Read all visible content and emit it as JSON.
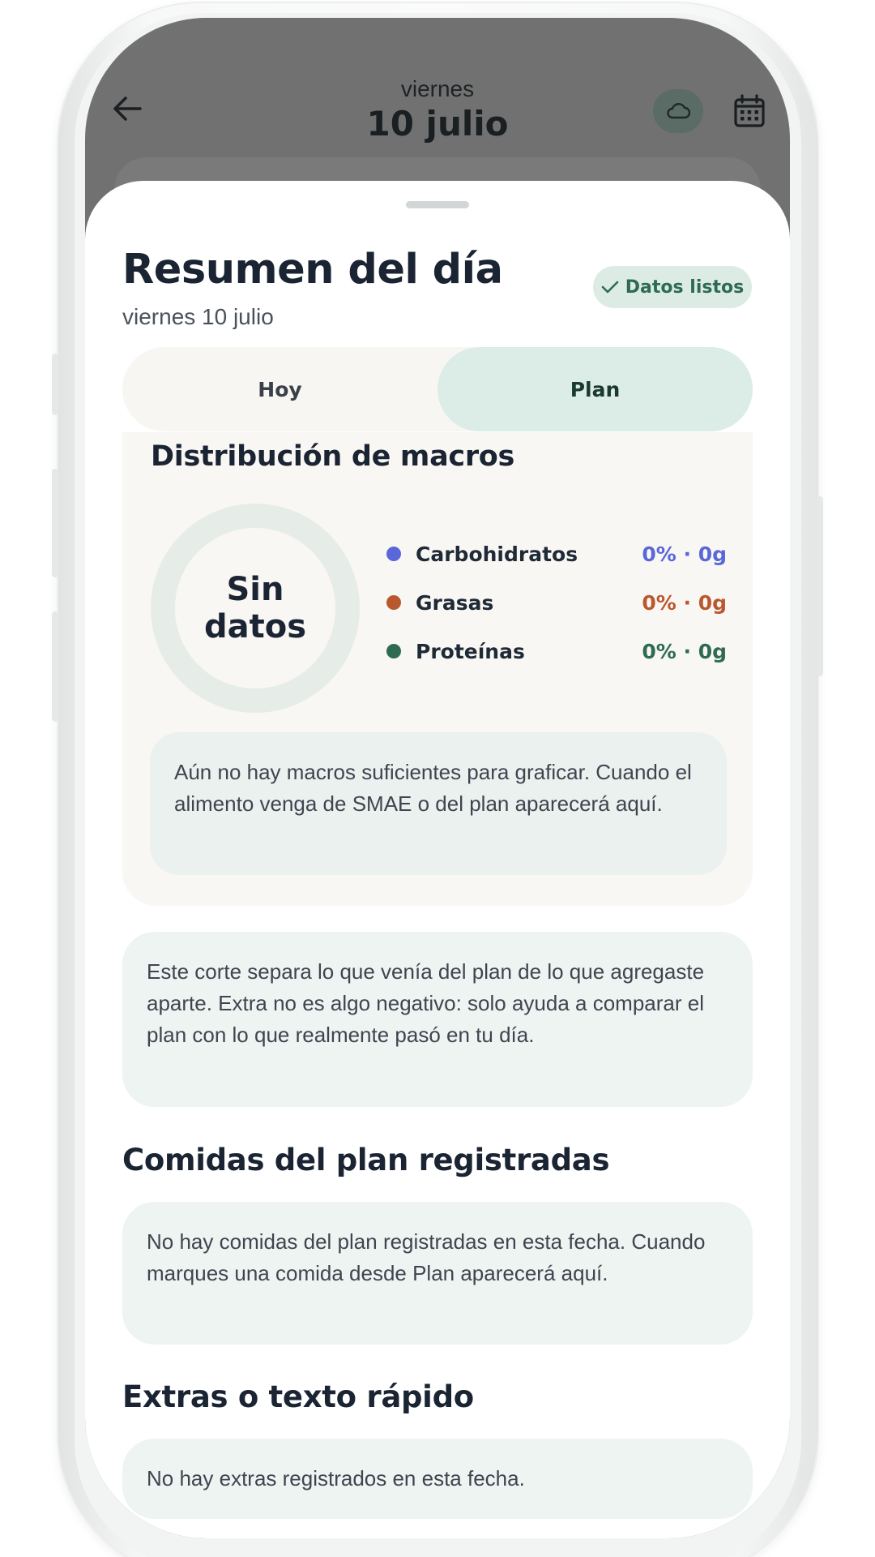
{
  "header": {
    "day_name": "viernes",
    "date": "10 julio"
  },
  "sheet": {
    "title": "Resumen del día",
    "subtitle": "viernes 10 julio",
    "badge": "Datos listos",
    "tabs": [
      {
        "label": "Hoy",
        "active": false
      },
      {
        "label": "Plan",
        "active": true
      }
    ]
  },
  "macros": {
    "title": "Distribución de macros",
    "donut_line1": "Sin",
    "donut_line2": "datos",
    "items": [
      {
        "name": "Carbohidratos",
        "value": "0% · 0g",
        "color": "#5a67d8"
      },
      {
        "name": "Grasas",
        "value": "0% · 0g",
        "color": "#b9582e"
      },
      {
        "name": "Proteínas",
        "value": "0% · 0g",
        "color": "#2f6b54"
      }
    ],
    "note": "Aún no hay macros suficientes para graficar. Cuando el alimento venga de SMAE o del plan aparecerá aquí."
  },
  "info": {
    "text": "Este corte separa lo que venía del plan de lo que agregaste aparte. Extra no es algo negativo: solo ayuda a comparar el plan con lo que realmente pasó en tu día."
  },
  "plan_meals": {
    "title": "Comidas del plan registradas",
    "empty": "No hay comidas del plan registradas en esta fecha. Cuando marques una comida desde Plan aparecerá aquí."
  },
  "extras": {
    "title": "Extras o texto rápido",
    "empty": "No hay extras registrados en esta fecha."
  },
  "colors": {
    "accent_green": "#2f6b54",
    "carbs": "#5a67d8",
    "fats": "#b9582e",
    "protein": "#2f6b54"
  }
}
